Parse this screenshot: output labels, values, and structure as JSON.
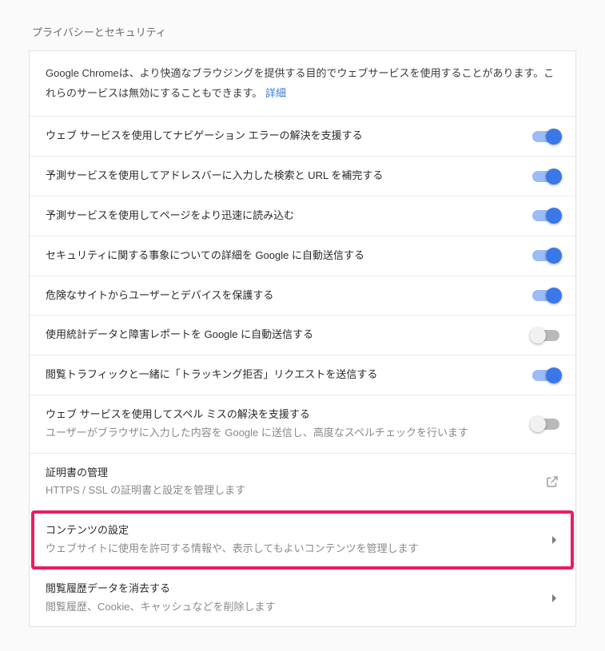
{
  "section_title": "プライバシーとセキュリティ",
  "intro": {
    "text": "Google Chromeは、より快適なブラウジングを提供する目的でウェブサービスを使用することがあります。これらのサービスは無効にすることもできます。",
    "link": "詳細"
  },
  "rows": [
    {
      "label": "ウェブ サービスを使用してナビゲーション エラーの解決を支援する",
      "on": true
    },
    {
      "label": "予測サービスを使用してアドレスバーに入力した検索と URL を補完する",
      "on": true
    },
    {
      "label": "予測サービスを使用してページをより迅速に読み込む",
      "on": true
    },
    {
      "label": "セキュリティに関する事象についての詳細を Google に自動送信する",
      "on": true
    },
    {
      "label": "危険なサイトからユーザーとデバイスを保護する",
      "on": true
    },
    {
      "label": "使用統計データと障害レポートを Google に自動送信する",
      "on": false
    },
    {
      "label": "閲覧トラフィックと一緒に「トラッキング拒否」リクエストを送信する",
      "on": true
    },
    {
      "label": "ウェブ サービスを使用してスペル ミスの解決を支援する",
      "sub": "ユーザーがブラウザに入力した内容を Google に送信し、高度なスペルチェックを行います",
      "on": false
    }
  ],
  "cert": {
    "label": "証明書の管理",
    "sub": "HTTPS / SSL の証明書と設定を管理します"
  },
  "content": {
    "label": "コンテンツの設定",
    "sub": "ウェブサイトに使用を許可する情報や、表示してもよいコンテンツを管理します"
  },
  "clear": {
    "label": "閲覧履歴データを消去する",
    "sub": "閲覧履歴、Cookie、キャッシュなどを削除します"
  }
}
